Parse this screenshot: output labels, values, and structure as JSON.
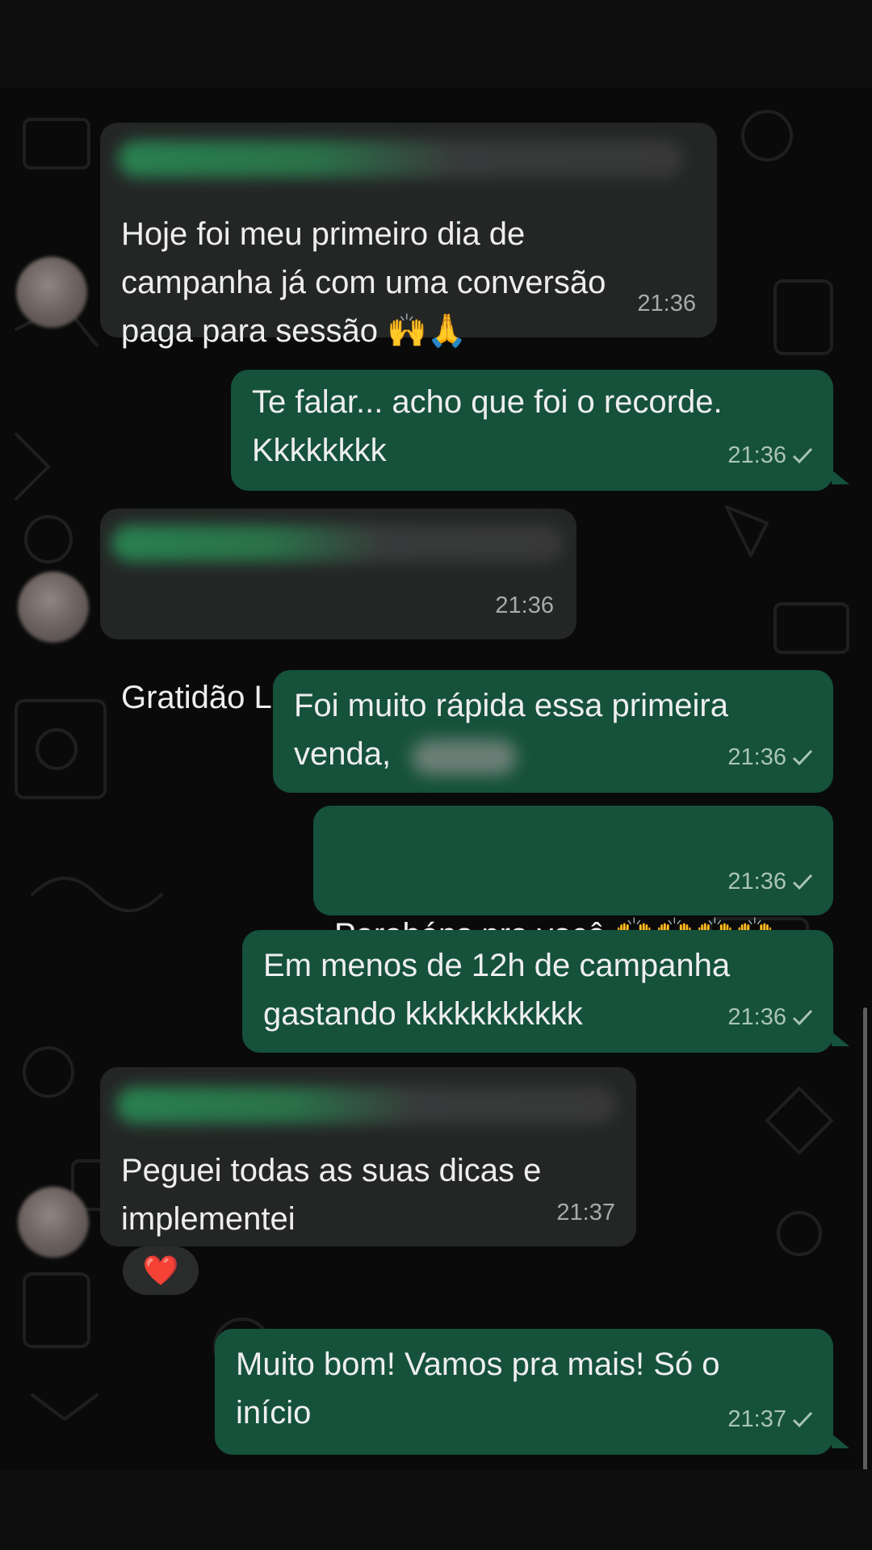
{
  "messages": [
    {
      "id": "m1",
      "direction": "in",
      "text_lines": [
        "Hoje foi meu primeiro dia de",
        "campanha já com uma conversão",
        "paga para sessão 🙌🙏"
      ],
      "time": "21:36"
    },
    {
      "id": "m2",
      "direction": "out",
      "text_lines": [
        "Te falar... acho que foi o recorde.",
        "Kkkkkkkk"
      ],
      "time": "21:36",
      "status": "sent"
    },
    {
      "id": "m3",
      "direction": "in",
      "text_lines": [
        "Gratidão Lucas"
      ],
      "time": "21:36"
    },
    {
      "id": "m4",
      "direction": "out",
      "text_lines": [
        "Foi muito rápida essa primeira",
        "venda,"
      ],
      "time": "21:36",
      "status": "sent"
    },
    {
      "id": "m5",
      "direction": "out",
      "text_lines": [
        "Parabéns pra você 🙌🙌🙌🙌"
      ],
      "time": "21:36",
      "status": "sent"
    },
    {
      "id": "m6",
      "direction": "out",
      "text_lines": [
        "Em menos de 12h de campanha",
        "gastando kkkkkkkkkkk"
      ],
      "time": "21:36",
      "status": "sent"
    },
    {
      "id": "m7",
      "direction": "in",
      "text_lines": [
        "Peguei todas as suas dicas e",
        "implementei"
      ],
      "time": "21:37",
      "reaction": "❤️"
    },
    {
      "id": "m8",
      "direction": "out",
      "text_lines": [
        "Muito bom! Vamos pra mais! Só o",
        "início"
      ],
      "time": "21:37",
      "status": "sent"
    }
  ],
  "icons": {
    "sent_status": "single-check-icon",
    "reaction": "heart-icon"
  },
  "colors": {
    "background": "#0a0a0a",
    "incoming_bubble": "#242626",
    "outgoing_bubble": "#15513b",
    "text": "#eeeeee"
  }
}
